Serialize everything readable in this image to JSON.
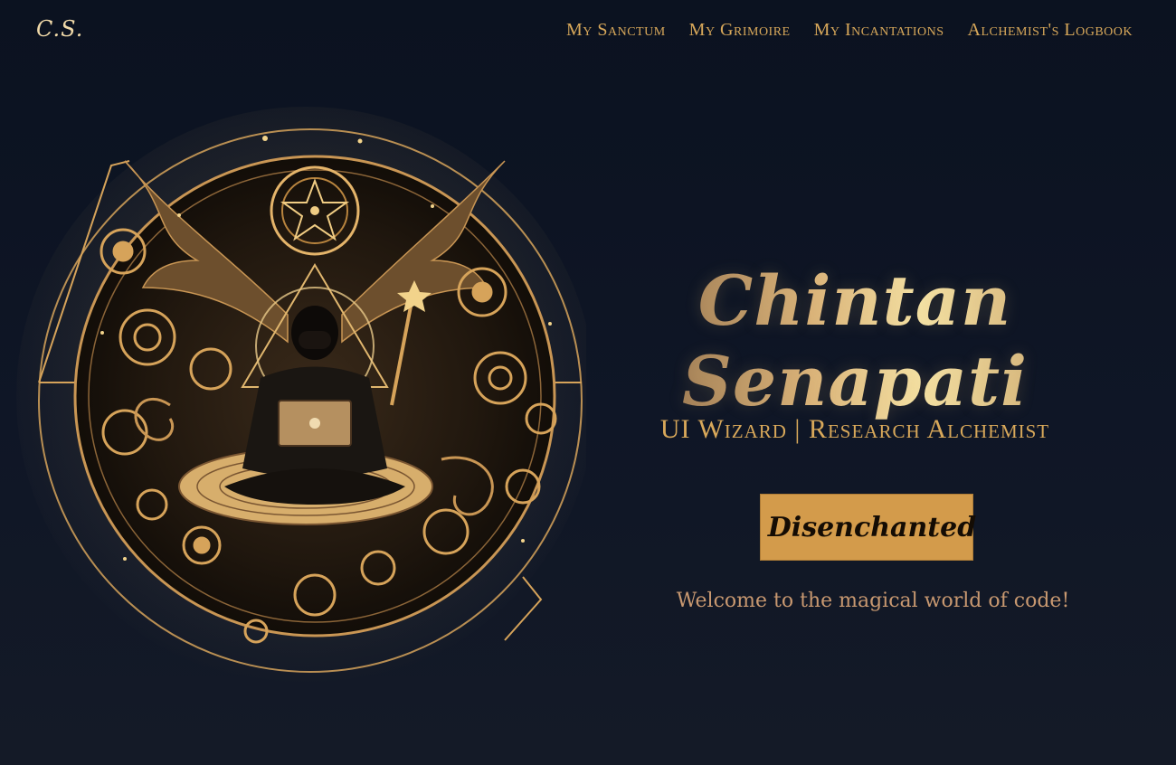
{
  "brand": {
    "logo_text": "C.S."
  },
  "nav": {
    "items": [
      {
        "label": "My Sanctum"
      },
      {
        "label": "My Grimoire"
      },
      {
        "label": "My Incantations"
      },
      {
        "label": "Alchemist's Logbook"
      }
    ]
  },
  "hero": {
    "name": "Chintan Senapati",
    "subtitle": "UI Wizard | Research Alchemist",
    "toggle_label": "Disenchanted",
    "toggle_icon": "toggle-icon",
    "welcome": "Welcome to the magical world of code!"
  },
  "colors": {
    "background": "#0f1626",
    "gold": "#d8a85a",
    "button": "#d39b4b"
  }
}
